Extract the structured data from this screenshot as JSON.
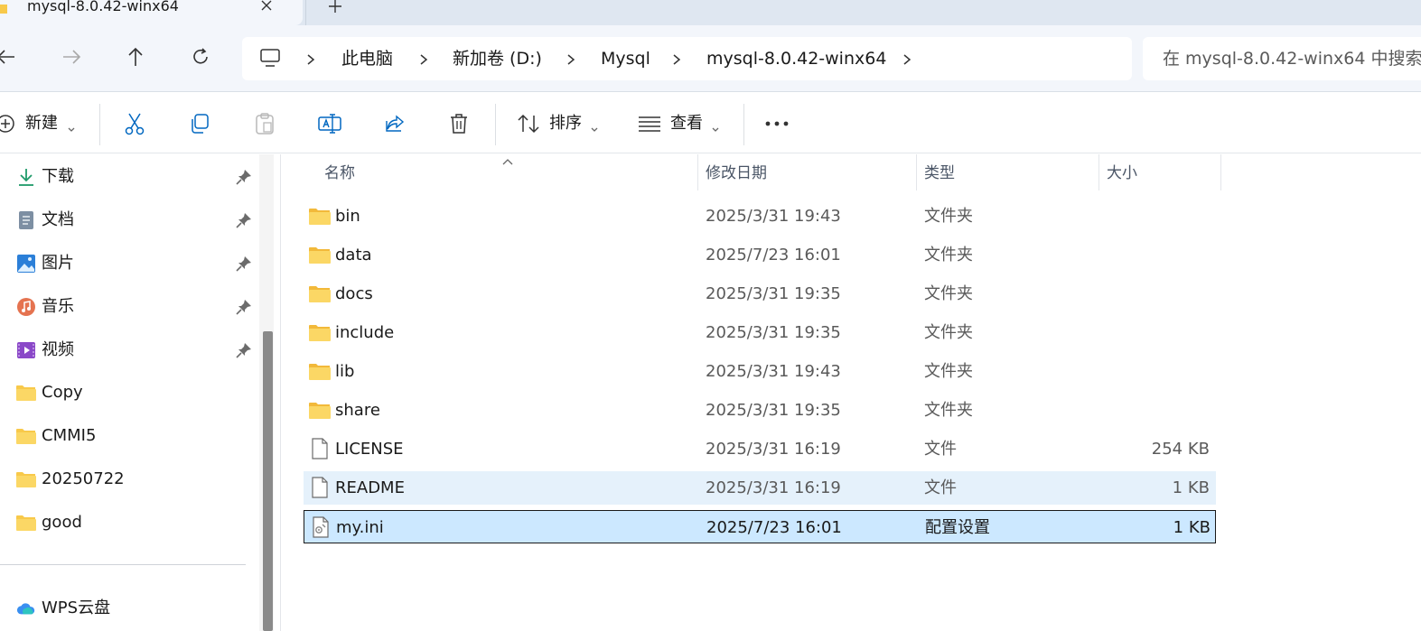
{
  "window": {
    "tab_title": "mysql-8.0.42-winx64",
    "new_tab_label": "+"
  },
  "address_bar": {
    "breadcrumbs": [
      "此电脑",
      "新加卷 (D:)",
      "Mysql",
      "mysql-8.0.42-winx64"
    ],
    "search_placeholder": "在 mysql-8.0.42-winx64 中搜索"
  },
  "toolbar": {
    "new_label": "新建",
    "sort_label": "排序",
    "view_label": "查看"
  },
  "sidebar": {
    "items": [
      {
        "label": "下载",
        "icon": "download-icon",
        "pinned": true
      },
      {
        "label": "文档",
        "icon": "documents-icon",
        "pinned": true
      },
      {
        "label": "图片",
        "icon": "pictures-icon",
        "pinned": true
      },
      {
        "label": "音乐",
        "icon": "music-icon",
        "pinned": true
      },
      {
        "label": "视频",
        "icon": "videos-icon",
        "pinned": true
      },
      {
        "label": "Copy",
        "icon": "folder-icon",
        "pinned": false
      },
      {
        "label": "CMMI5",
        "icon": "folder-icon",
        "pinned": false
      },
      {
        "label": "20250722",
        "icon": "folder-icon",
        "pinned": false
      },
      {
        "label": "good",
        "icon": "folder-icon",
        "pinned": false
      }
    ],
    "cloud_label": "WPS云盘"
  },
  "file_list": {
    "columns": [
      "名称",
      "修改日期",
      "类型",
      "大小"
    ],
    "rows": [
      {
        "name": "bin",
        "date": "2025/3/31 19:43",
        "type": "文件夹",
        "size": "",
        "kind": "folder"
      },
      {
        "name": "data",
        "date": "2025/7/23 16:01",
        "type": "文件夹",
        "size": "",
        "kind": "folder"
      },
      {
        "name": "docs",
        "date": "2025/3/31 19:35",
        "type": "文件夹",
        "size": "",
        "kind": "folder"
      },
      {
        "name": "include",
        "date": "2025/3/31 19:35",
        "type": "文件夹",
        "size": "",
        "kind": "folder"
      },
      {
        "name": "lib",
        "date": "2025/3/31 19:43",
        "type": "文件夹",
        "size": "",
        "kind": "folder"
      },
      {
        "name": "share",
        "date": "2025/3/31 19:35",
        "type": "文件夹",
        "size": "",
        "kind": "folder"
      },
      {
        "name": "LICENSE",
        "date": "2025/3/31 16:19",
        "type": "文件",
        "size": "254 KB",
        "kind": "file"
      },
      {
        "name": "README",
        "date": "2025/3/31 16:19",
        "type": "文件",
        "size": "1 KB",
        "kind": "file",
        "state": "hover"
      },
      {
        "name": "my.ini",
        "date": "2025/7/23 16:01",
        "type": "配置设置",
        "size": "1 KB",
        "kind": "ini",
        "state": "selected"
      }
    ]
  },
  "colors": {
    "accent": "#0067c0",
    "folder": "#f8c94a",
    "selected_bg": "#cce8ff",
    "hover_bg": "#e5f1fb"
  }
}
